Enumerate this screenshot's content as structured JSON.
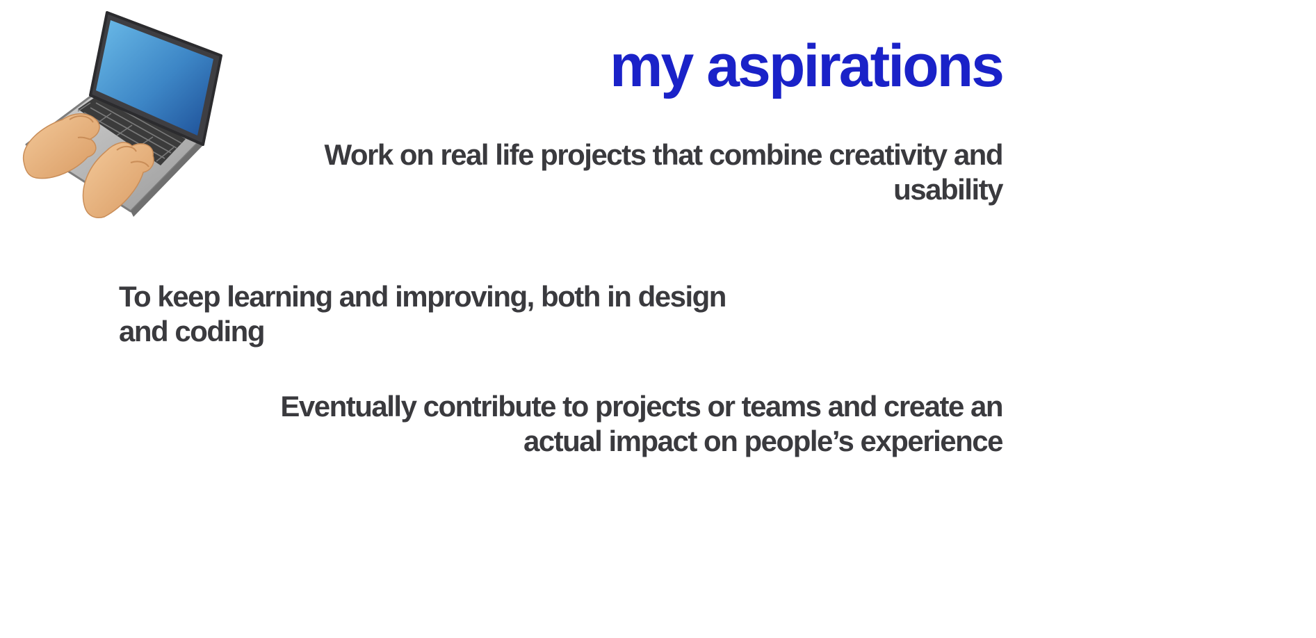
{
  "page": {
    "title": "my aspirations",
    "illustration_icon": "laptop-typing-icon",
    "colors": {
      "title": "#1a22c8",
      "body_text": "#3a3a3e",
      "background": "#ffffff"
    }
  },
  "aspirations": [
    "Work on real life projects that combine creativity and usability",
    "To keep learning and improving, both in design and coding",
    "Eventually contribute to projects or teams and create an actual impact on people’s experience"
  ]
}
